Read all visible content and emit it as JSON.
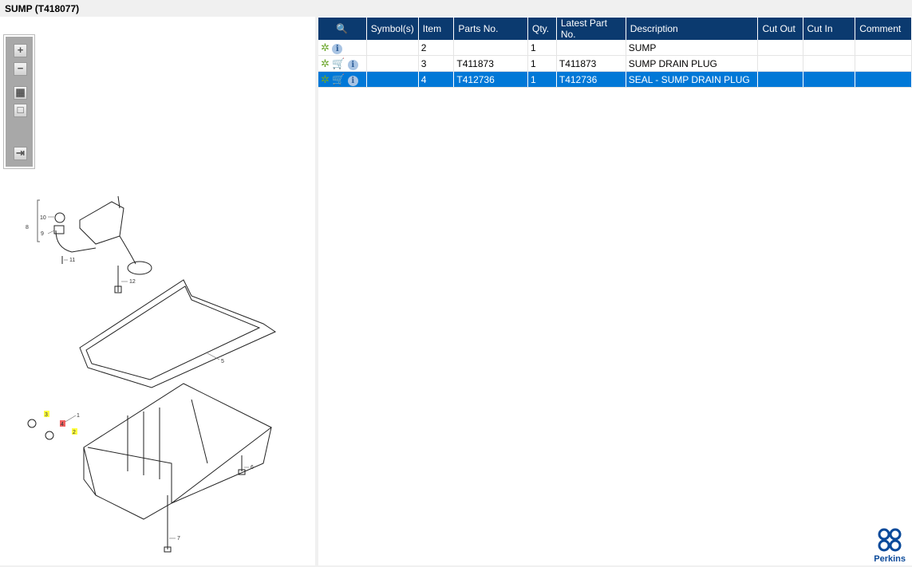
{
  "title": "SUMP (T418077)",
  "toolbar": {
    "zoom_in": "+",
    "zoom_out": "−",
    "fit": "▦",
    "actual": "□",
    "export": "⇥"
  },
  "diagram": {
    "callouts": [
      "1",
      "2",
      "3",
      "4",
      "5",
      "6",
      "7",
      "8",
      "9",
      "10",
      "11",
      "12"
    ],
    "highlighted": {
      "yellow": [
        "2",
        "3"
      ],
      "red": [
        "4"
      ]
    }
  },
  "table": {
    "headers": [
      "",
      "Symbol(s)",
      "Item",
      "Parts No.",
      "Qty.",
      "Latest Part No.",
      "Description",
      "Cut Out",
      "Cut In",
      "Comment"
    ],
    "rows": [
      {
        "item": "2",
        "part": "",
        "qty": "1",
        "latest": "",
        "desc": "SUMP",
        "cart": false,
        "selected": false
      },
      {
        "item": "3",
        "part": "T411873",
        "qty": "1",
        "latest": "T411873",
        "desc": "SUMP DRAIN PLUG",
        "cart": true,
        "selected": false
      },
      {
        "item": "4",
        "part": "T412736",
        "qty": "1",
        "latest": "T412736",
        "desc": "SEAL - SUMP DRAIN PLUG",
        "cart": true,
        "selected": true
      }
    ]
  },
  "logo": {
    "text": "Perkins"
  },
  "colors": {
    "header": "#0b3a6f",
    "selected": "#0078d7"
  }
}
